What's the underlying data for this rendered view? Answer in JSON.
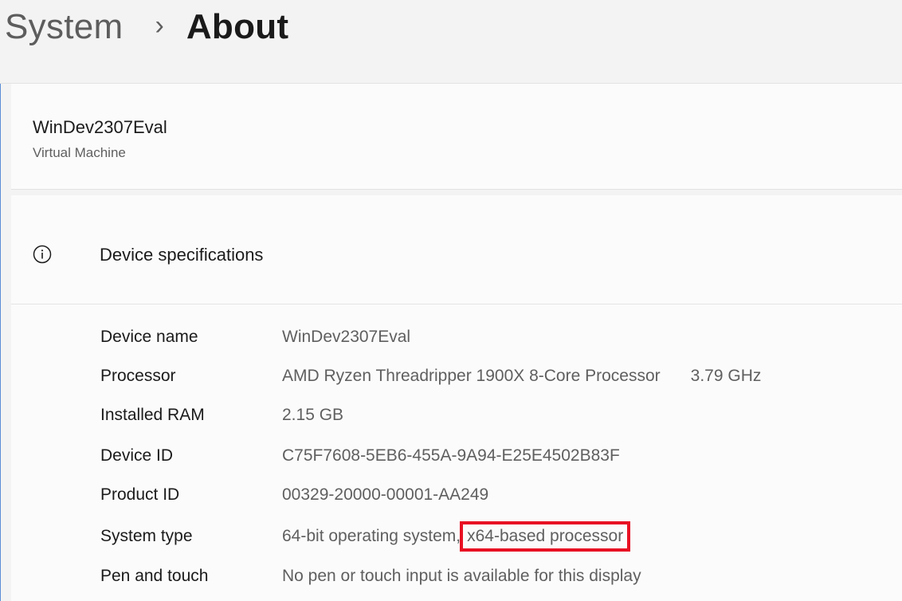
{
  "breadcrumb": {
    "parent": "System",
    "separator": "›",
    "current": "About"
  },
  "device": {
    "name": "WinDev2307Eval",
    "type": "Virtual Machine"
  },
  "specs": {
    "icon": "info-icon",
    "title": "Device specifications",
    "rows": [
      {
        "label": "Device name",
        "value": "WinDev2307Eval"
      },
      {
        "label": "Processor",
        "value": "AMD Ryzen Threadripper 1900X 8-Core Processor",
        "extra": "3.79 GHz"
      },
      {
        "label": "Installed RAM",
        "value": "2.15 GB"
      },
      {
        "label": "Device ID",
        "value": "C75F7608-5EB6-455A-9A94-E25E4502B83F"
      },
      {
        "label": "Product ID",
        "value": "00329-20000-00001-AA249"
      },
      {
        "label": "System type",
        "value": "64-bit operating system,",
        "highlighted_value": "x64-based processor"
      },
      {
        "label": "Pen and touch",
        "value": "No pen or touch input is available for this display"
      }
    ]
  },
  "colors": {
    "highlight_box": "#e81123",
    "window_border": "#5b8fd6"
  }
}
